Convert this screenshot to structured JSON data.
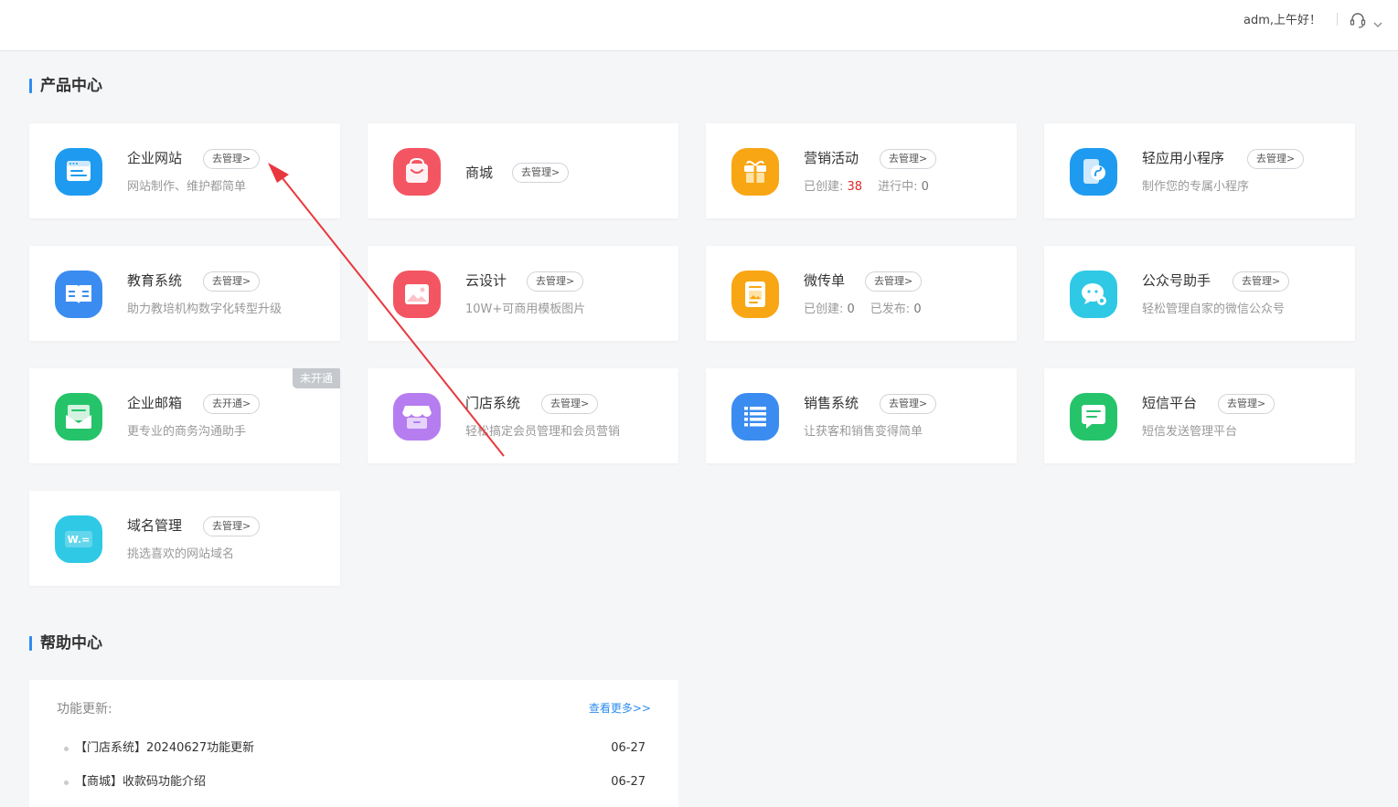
{
  "header": {
    "greeting": "adm,上午好！",
    "support_icon": "headset-icon",
    "menu_icon": "chevron-down-icon"
  },
  "product_center": {
    "title": "产品中心",
    "cards": [
      {
        "title": "企业网站",
        "button": "去管理>",
        "desc": "网站制作、维护都简单",
        "icon": "website-browser-icon",
        "color": "#1e9bf0"
      },
      {
        "title": "商城",
        "button": "去管理>",
        "icon": "shopping-bag-icon",
        "color": "#f45562"
      },
      {
        "title": "营销活动",
        "button": "去管理>",
        "stat1_label": "已创建: ",
        "stat1_value": "38",
        "stat2_label": "进行中: ",
        "stat2_value": "0",
        "icon": "gift-icon",
        "color": "#f8a614"
      },
      {
        "title": "轻应用小程序",
        "button": "去管理>",
        "desc": "制作您的专属小程序",
        "icon": "mini-program-icon",
        "color": "#1e9bf0"
      },
      {
        "title": "教育系统",
        "button": "去管理>",
        "desc": "助力教培机构数字化转型升级",
        "icon": "book-icon",
        "color": "#3b8cf0"
      },
      {
        "title": "云设计",
        "button": "去管理>",
        "desc": "10W+可商用模板图片",
        "icon": "image-icon",
        "color": "#f45562"
      },
      {
        "title": "微传单",
        "button": "去管理>",
        "stat1_label": "已创建: ",
        "stat1_value": "0",
        "stat2_label": "已发布: ",
        "stat2_value": "0",
        "icon": "flyer-icon",
        "color": "#f8a614"
      },
      {
        "title": "公众号助手",
        "button": "去管理>",
        "desc": "轻松管理自家的微信公众号",
        "icon": "wechat-settings-icon",
        "color": "#2fc9e6"
      },
      {
        "title": "企业邮箱",
        "button": "去开通>",
        "desc": "更专业的商务沟通助手",
        "badge": "未开通",
        "icon": "mail-icon",
        "color": "#25c46a"
      },
      {
        "title": "门店系统",
        "button": "去管理>",
        "desc": "轻松搞定会员管理和会员营销",
        "icon": "store-icon",
        "color": "#b67df0"
      },
      {
        "title": "销售系统",
        "button": "去管理>",
        "desc": "让获客和销售变得简单",
        "icon": "list-icon",
        "color": "#3b8cf0"
      },
      {
        "title": "短信平台",
        "button": "去管理>",
        "desc": "短信发送管理平台",
        "icon": "message-icon",
        "color": "#25c46a"
      },
      {
        "title": "域名管理",
        "button": "去管理>",
        "desc": "挑选喜欢的网站域名",
        "icon": "domain-icon",
        "color": "#2fc9e6"
      }
    ]
  },
  "help_center": {
    "title": "帮助中心",
    "label": "功能更新:",
    "more": "查看更多>>",
    "items": [
      {
        "title": "【门店系统】20240627功能更新",
        "date": "06-27"
      },
      {
        "title": "【商城】收款码功能介绍",
        "date": "06-27"
      }
    ]
  },
  "annotation": {
    "color": "#e8383d",
    "icon": "red-arrow-annotation"
  }
}
